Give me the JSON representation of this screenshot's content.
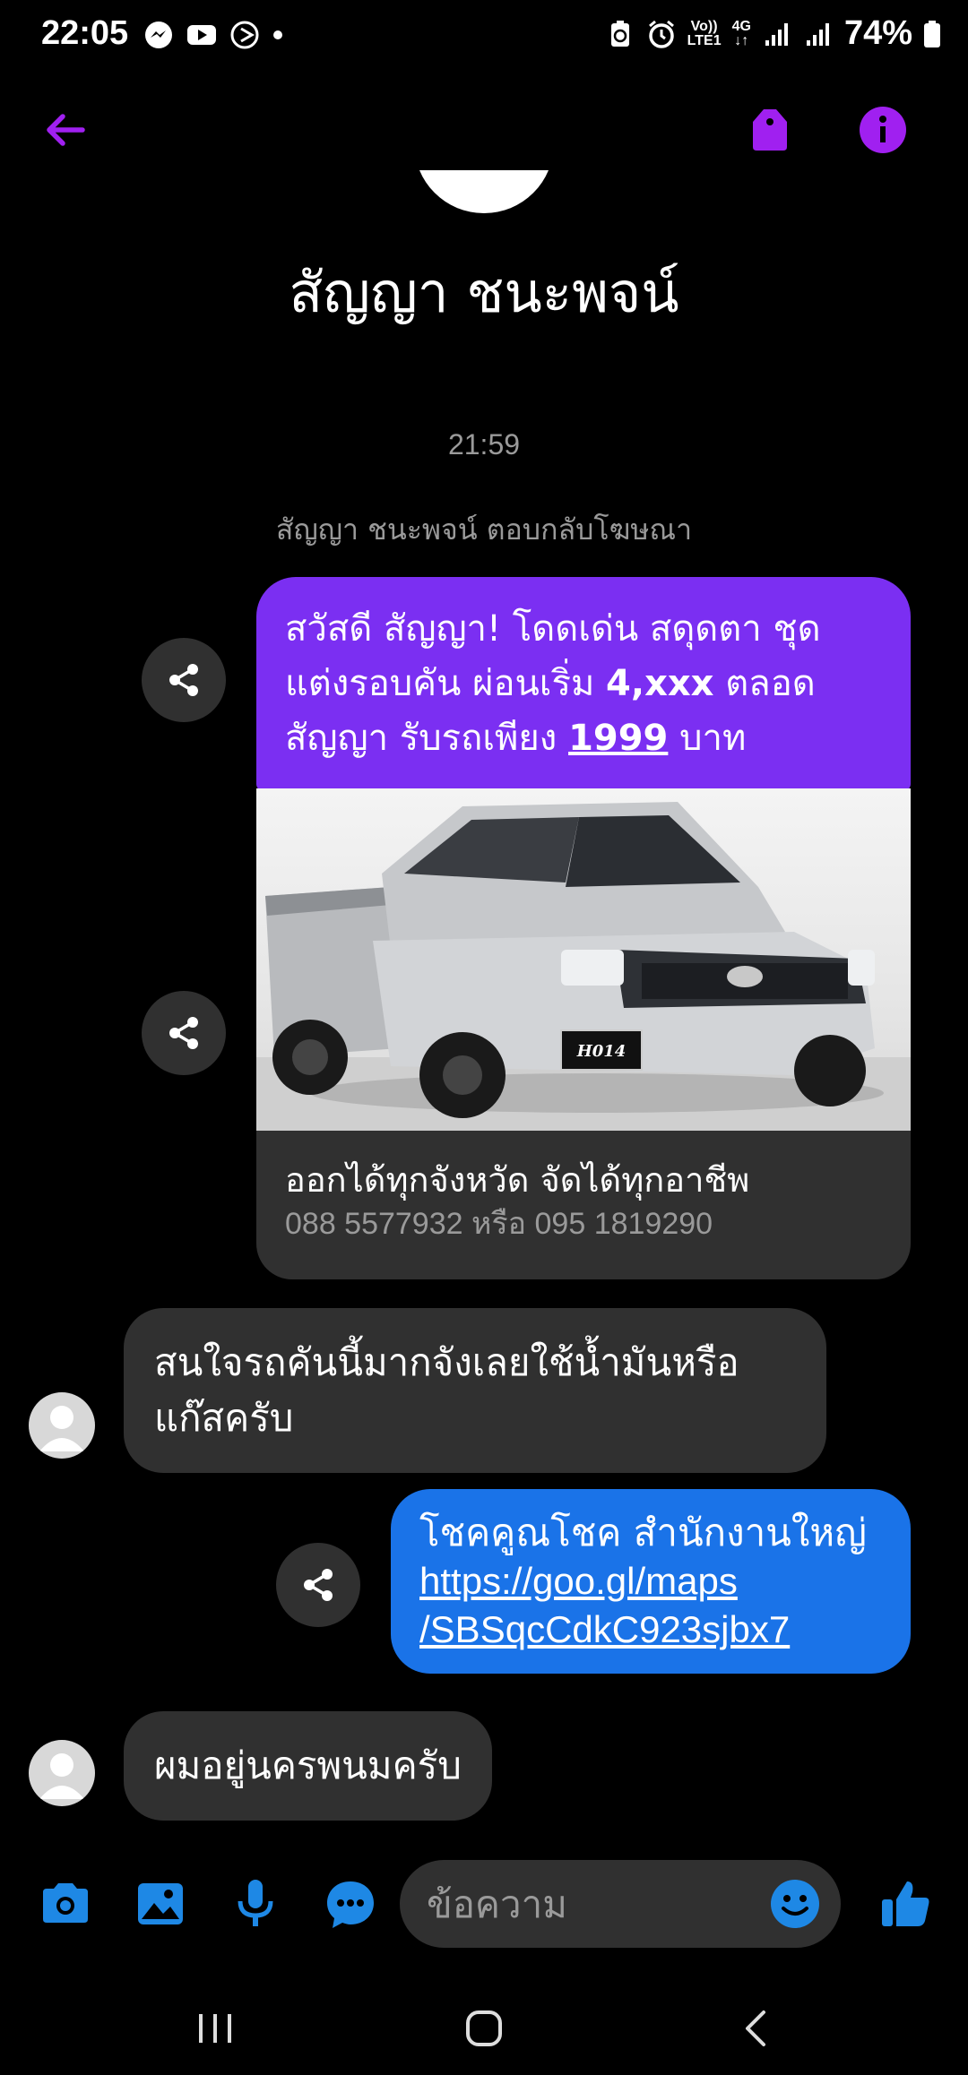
{
  "status": {
    "time": "22:05",
    "battery": "74%",
    "volte": "Vo))",
    "lte": "LTE1",
    "network": "4G"
  },
  "header": {
    "back_icon": "arrow-left-icon",
    "tag_icon": "tag-icon",
    "info_icon": "info-icon",
    "accent": "#a020f0"
  },
  "profile": {
    "name": "สัญญา ชนะพจน์"
  },
  "thread": {
    "timestamp": "21:59",
    "reply_note": "สัญญา ชนะพจน์ ตอบกลับโฆษณา",
    "ad": {
      "text_part1": "สวัสดี สัญญา! โดดเด่น สดุดตา ชุด แต่งรอบคัน ผ่อนเริ่ม ",
      "text_bold": "4,xxx",
      "text_part2": " ตลอด สัญญา รับรถเพียง ",
      "text_underline": "1999",
      "text_part3": " บาท",
      "image_plate": "H014",
      "caption_title": "ออกได้ทุกจังหวัด จัดได้ทุกอาชีพ",
      "caption_phone": "088 5577932 หรือ 095 1819290"
    },
    "msg1": "สนใจรถคันนี้มากจังเลยใช้น้ำมันหรือแก๊สครับ",
    "reply": {
      "title": "โชคคูณโชค สำนักงานใหญ่",
      "link_line1": "https://goo.gl/maps",
      "link_line2": "/SBSqcCdkC923sjbx7"
    },
    "msg2": "ผมอยู่นครพนมครับ"
  },
  "composer": {
    "placeholder": "ข้อความ",
    "icons": [
      "camera-icon",
      "image-icon",
      "microphone-icon",
      "chat-icon",
      "emoji-icon",
      "thumbs-up-icon"
    ],
    "accent": "#1e88e5"
  },
  "navbar": {
    "icons": [
      "recent-apps-icon",
      "home-icon",
      "back-icon"
    ]
  }
}
